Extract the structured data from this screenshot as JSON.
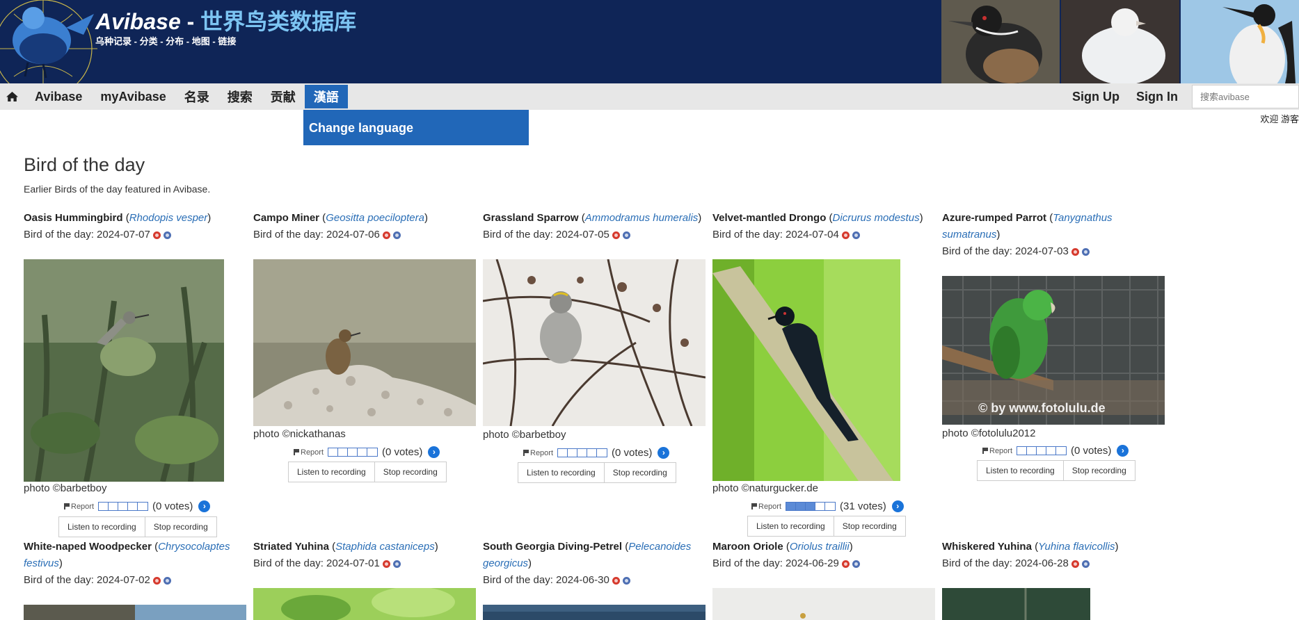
{
  "header": {
    "brand_en": "Avibase",
    "brand_sep": " - ",
    "brand_cn": "世界鸟类数据库",
    "subnav": [
      "乌种记录",
      "分类",
      "分布",
      "地图",
      "链接"
    ],
    "subnav_sep": " - "
  },
  "nav": {
    "home_icon": "home-icon",
    "items": [
      "Avibase",
      "myAvibase",
      "名录",
      "搜索",
      "贡献",
      "漢語"
    ],
    "active_index": 5,
    "dropdown_item": "Change language",
    "signup": "Sign Up",
    "signin": "Sign In",
    "search_placeholder": "搜索avibase",
    "welcome": "欢迎 游客"
  },
  "main": {
    "title": "Bird of the day",
    "description": "Earlier Birds of the day featured in Avibase."
  },
  "labels": {
    "report": "Report",
    "listen": "Listen to recording",
    "stop": "Stop recording"
  },
  "birds": [
    {
      "name": "Oasis Hummingbird",
      "sci": "Rhodopis vesper",
      "date": "Bird of the day: 2024-07-07",
      "credit": "photo ©barbetboy",
      "votes": "(0 votes)",
      "rating": 0
    },
    {
      "name": "Campo Miner",
      "sci": "Geositta poeciloptera",
      "date": "Bird of the day: 2024-07-06",
      "credit": "photo ©nickathanas",
      "votes": "(0 votes)",
      "rating": 0
    },
    {
      "name": "Grassland Sparrow",
      "sci": "Ammodramus humeralis",
      "date": "Bird of the day: 2024-07-05",
      "credit": "photo ©barbetboy",
      "votes": "(0 votes)",
      "rating": 0
    },
    {
      "name": "Velvet-mantled Drongo",
      "sci": "Dicrurus modestus",
      "date": "Bird of the day: 2024-07-04",
      "credit": "photo ©naturgucker.de",
      "votes": "(31 votes)",
      "rating": 3
    },
    {
      "name": "Azure-rumped Parrot",
      "sci": "Tanygnathus sumatranus",
      "date": "Bird of the day: 2024-07-03",
      "credit": "photo ©fotolulu2012",
      "votes": "(0 votes)",
      "rating": 0,
      "watermark": "© by www.fotolulu.de"
    },
    {
      "name": "White-naped Woodpecker",
      "sci": "Chrysocolaptes festivus",
      "date": "Bird of the day: 2024-07-02"
    },
    {
      "name": "Striated Yuhina",
      "sci": "Staphida castaniceps",
      "date": "Bird of the day: 2024-07-01"
    },
    {
      "name": "South Georgia Diving-Petrel",
      "sci": "Pelecanoides georgicus",
      "date": "Bird of the day: 2024-06-30"
    },
    {
      "name": "Maroon Oriole",
      "sci": "Oriolus traillii",
      "date": "Bird of the day: 2024-06-29"
    },
    {
      "name": "Whiskered Yuhina",
      "sci": "Yuhina flavicollis",
      "date": "Bird of the day: 2024-06-28"
    }
  ]
}
